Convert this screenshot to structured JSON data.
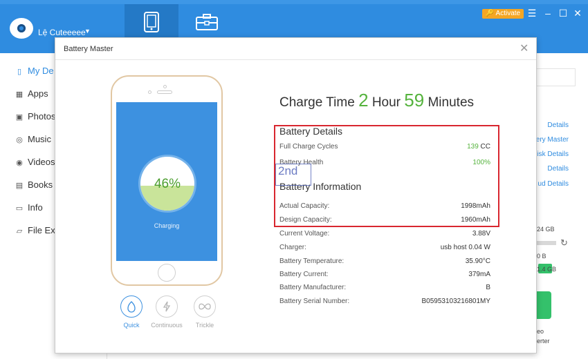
{
  "app": {
    "user_name": "Lệ Cuteeeee",
    "activate_label": "Activate",
    "menu_icon": "menu-icon",
    "minimize_icon": "minimize-icon",
    "maximize_icon": "maximize-icon",
    "close_icon": "close-icon",
    "accent_color": "#2f8ce0"
  },
  "sidebar": {
    "items": [
      {
        "label": "My De",
        "icon": "device-icon",
        "active": true
      },
      {
        "label": "Apps",
        "icon": "apps-icon"
      },
      {
        "label": "Photos",
        "icon": "photos-icon"
      },
      {
        "label": "Music",
        "icon": "music-icon"
      },
      {
        "label": "Videos",
        "icon": "videos-icon"
      },
      {
        "label": "Books",
        "icon": "books-icon"
      },
      {
        "label": "Info",
        "icon": "info-icon"
      },
      {
        "label": "File Ex",
        "icon": "folder-icon"
      }
    ]
  },
  "right_panel": {
    "links": [
      "Details",
      "ery Master",
      "isk Details",
      "Details",
      "ud Details"
    ],
    "storage_text": "24 GB",
    "text_1": "0 B",
    "text_2": "1.4 GB",
    "tool_label_1": "eo",
    "tool_label_2": "erter"
  },
  "modal": {
    "title": "Battery Master",
    "charge_time": {
      "prefix": "Charge Time",
      "hours": "2",
      "hour_label": "Hour",
      "minutes": "59",
      "minute_label": "Minutes"
    },
    "battery_level": "46%",
    "battery_fraction": 0.46,
    "charging_status": "Charging",
    "modes": [
      {
        "label": "Quick",
        "icon": "quick-charge-icon",
        "active": true
      },
      {
        "label": "Continuous",
        "icon": "continuous-charge-icon"
      },
      {
        "label": "Trickle",
        "icon": "trickle-charge-icon"
      }
    ],
    "battery_details": {
      "heading": "Battery Details",
      "full_charge_cycles_label": "Full Charge Cycles",
      "full_charge_cycles_value": "139",
      "full_charge_cycles_unit": "CC",
      "battery_health_label": "Battery Health",
      "battery_health_value": "100%"
    },
    "battery_information": {
      "heading": "Battery Information",
      "rows": [
        {
          "label": "Actual Capacity:",
          "value": "1998mAh"
        },
        {
          "label": "Design Capacity:",
          "value": "1960mAh"
        },
        {
          "label": "Current Voltage:",
          "value": "3.88V"
        },
        {
          "label": "Charger:",
          "value": "usb host 0.04 W"
        },
        {
          "label": "Battery Temperature:",
          "value": "35.90°C"
        },
        {
          "label": "Battery Current:",
          "value": "379mA"
        },
        {
          "label": "Battery Manufacturer:",
          "value": "B"
        },
        {
          "label": "Battery Serial Number:",
          "value": "B05953103216801MY"
        }
      ]
    },
    "highlight_color": "#d8262f",
    "value_green": "#55b33d"
  },
  "watermark": {
    "text": "2nd"
  }
}
